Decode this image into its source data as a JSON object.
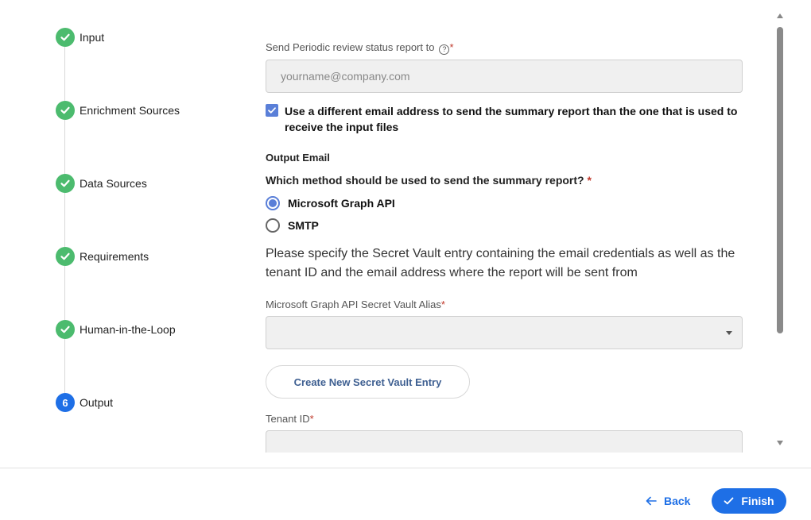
{
  "stepper": {
    "steps": [
      {
        "label": "Input",
        "status": "done"
      },
      {
        "label": "Enrichment Sources",
        "status": "done"
      },
      {
        "label": "Data Sources",
        "status": "done"
      },
      {
        "label": "Requirements",
        "status": "done"
      },
      {
        "label": "Human-in-the-Loop",
        "status": "done"
      },
      {
        "label": "Output",
        "status": "active",
        "number": "6"
      }
    ]
  },
  "form": {
    "report_to_label": "Send Periodic review status report to",
    "help_icon_glyph": "?",
    "required_mark": "*",
    "report_to_placeholder": "yourname@company.com",
    "different_email_checkbox": {
      "label": "Use a different email address to send the summary report than the one that is used to receive the input files",
      "checked": true
    },
    "output_email_title": "Output Email",
    "method_question": "Which method should be used to send the summary report?",
    "methods": [
      {
        "label": "Microsoft Graph API",
        "selected": true
      },
      {
        "label": "SMTP",
        "selected": false
      }
    ],
    "description": "Please specify the Secret Vault entry containing the email credentials as well as the tenant ID and the email address where the report will be sent from",
    "vault_alias_label": "Microsoft Graph API Secret Vault Alias",
    "vault_alias_value": "",
    "create_vault_button": "Create New Secret Vault Entry",
    "tenant_id_label": "Tenant ID",
    "tenant_id_value": ""
  },
  "footer": {
    "back_label": "Back",
    "finish_label": "Finish"
  },
  "colors": {
    "accent": "#1e6fe6",
    "done": "#4cbb6e",
    "checkbox": "#5a7fd8",
    "required": "#c0392b"
  }
}
